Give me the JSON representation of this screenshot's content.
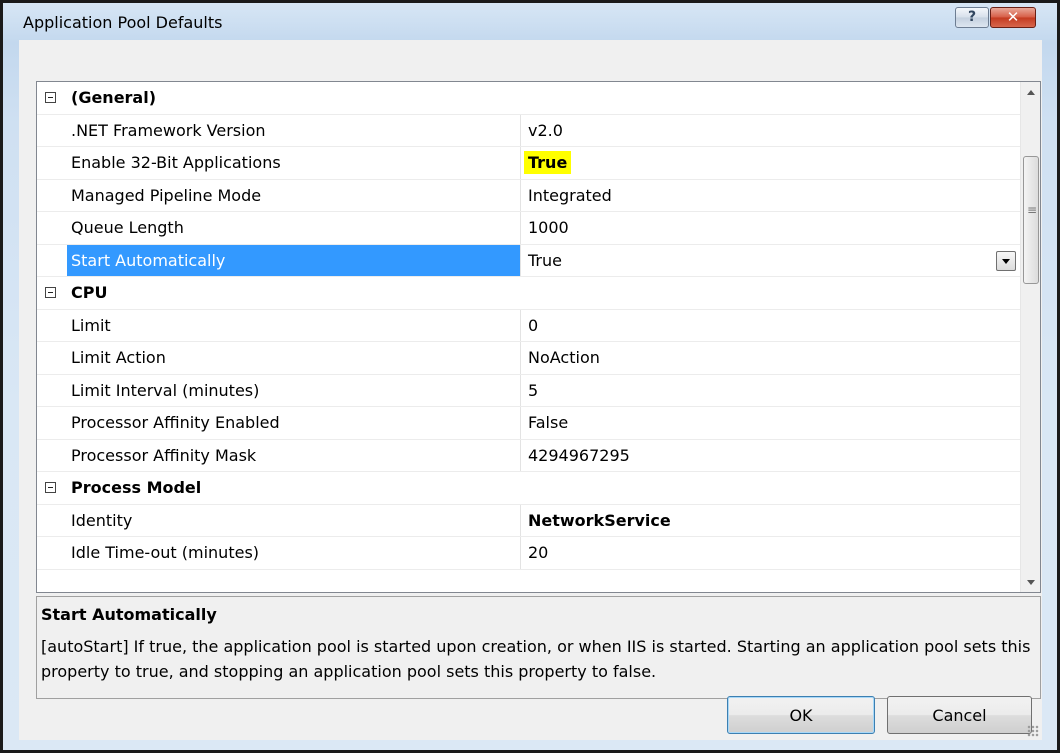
{
  "window": {
    "title": "Application Pool Defaults",
    "help_glyph": "?",
    "close_glyph": "✕"
  },
  "grid": {
    "categories": [
      {
        "label": "(General)",
        "properties": [
          {
            "name": ".NET Framework Version",
            "value": "v2.0"
          },
          {
            "name": "Enable 32-Bit Applications",
            "value": "True"
          },
          {
            "name": "Managed Pipeline Mode",
            "value": "Integrated"
          },
          {
            "name": "Queue Length",
            "value": "1000"
          },
          {
            "name": "Start Automatically",
            "value": "True"
          }
        ]
      },
      {
        "label": "CPU",
        "properties": [
          {
            "name": "Limit",
            "value": "0"
          },
          {
            "name": "Limit Action",
            "value": "NoAction"
          },
          {
            "name": "Limit Interval (minutes)",
            "value": "5"
          },
          {
            "name": "Processor Affinity Enabled",
            "value": "False"
          },
          {
            "name": "Processor Affinity Mask",
            "value": "4294967295"
          }
        ]
      },
      {
        "label": "Process Model",
        "properties": [
          {
            "name": "Identity",
            "value": "NetworkService"
          },
          {
            "name": "Idle Time-out (minutes)",
            "value": "20"
          }
        ]
      }
    ]
  },
  "description": {
    "title": "Start Automatically",
    "text": "[autoStart] If true, the application pool is started upon creation, or when IIS is started.  Starting an application pool sets this property to true, and stopping an application pool sets this property to false."
  },
  "buttons": {
    "ok": "OK",
    "cancel": "Cancel"
  },
  "colors": {
    "selection": "#3399ff",
    "highlight": "#ffff00"
  }
}
